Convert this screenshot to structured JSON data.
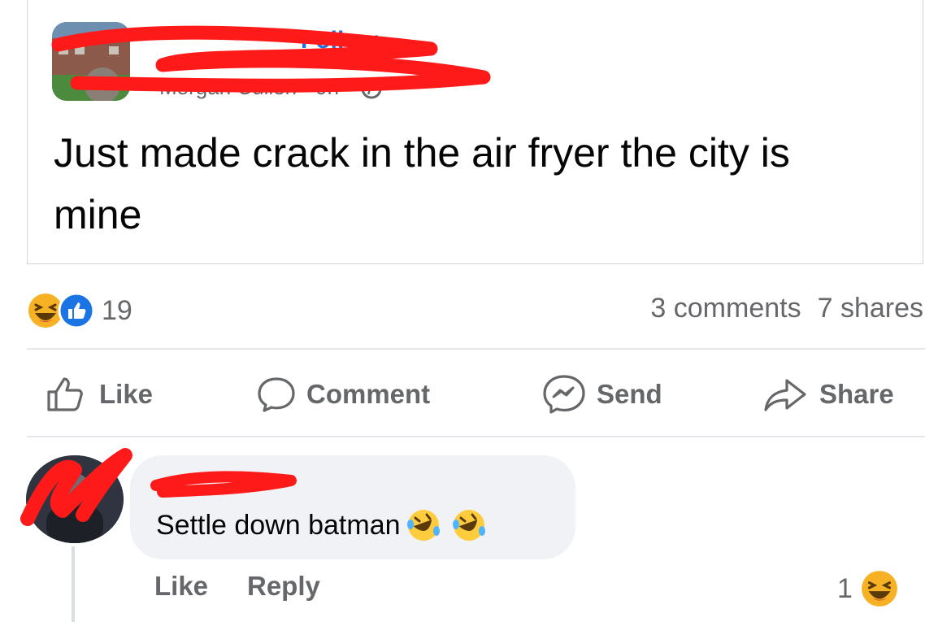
{
  "post": {
    "follow_label": "Follow",
    "meta_text": "Morgan Cullen · 9h ·",
    "text": "Just made crack in the air fryer the city is mine"
  },
  "reactions": {
    "count": "19"
  },
  "stats": {
    "comments": "3 comments",
    "shares": "7 shares"
  },
  "actions": {
    "like": "Like",
    "comment": "Comment",
    "send": "Send",
    "share": "Share"
  },
  "comment": {
    "text": "Settle down batman",
    "like": "Like",
    "reply": "Reply",
    "reaction_count": "1"
  },
  "colors": {
    "accent": "#1b74e4",
    "redaction": "#ff1a1a",
    "secondary_text": "#65676b"
  }
}
